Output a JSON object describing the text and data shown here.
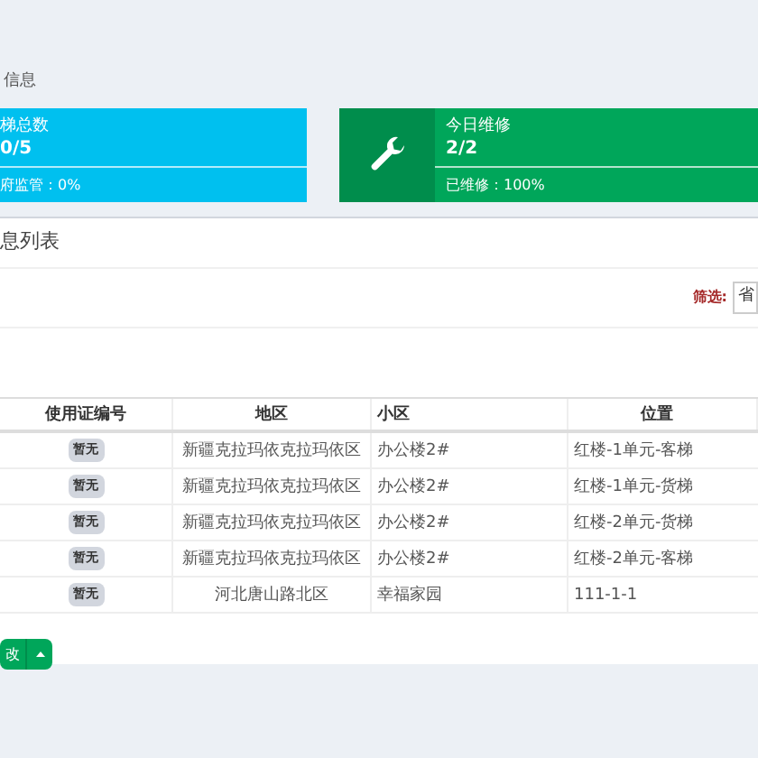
{
  "section_title": "信息",
  "cards": [
    {
      "kind": "plain",
      "label": "梯总数",
      "value": "0/5",
      "footer": "府监管：0%",
      "color": "#00c0ef"
    },
    {
      "kind": "icon",
      "label": "今日维修",
      "value": "2/2",
      "footer": "已维修：100%",
      "color": "#00a65a"
    }
  ],
  "panel": {
    "title": "息列表",
    "filter_label": "筛选:",
    "filter_value": "省"
  },
  "table": {
    "columns": [
      "使用证编号",
      "地区",
      "小区",
      "位置"
    ],
    "rows": [
      {
        "cert": "暂无",
        "region": "新疆克拉玛依克拉玛依区",
        "community": "办公楼2#",
        "location": "红楼-1单元-客梯"
      },
      {
        "cert": "暂无",
        "region": "新疆克拉玛依克拉玛依区",
        "community": "办公楼2#",
        "location": "红楼-1单元-货梯"
      },
      {
        "cert": "暂无",
        "region": "新疆克拉玛依克拉玛依区",
        "community": "办公楼2#",
        "location": "红楼-2单元-货梯"
      },
      {
        "cert": "暂无",
        "region": "新疆克拉玛依克拉玛依区",
        "community": "办公楼2#",
        "location": "红楼-2单元-客梯"
      },
      {
        "cert": "暂无",
        "region": "河北唐山路北区",
        "community": "幸福家园",
        "location": "111-1-1"
      }
    ]
  },
  "action_button": {
    "label": "改"
  }
}
